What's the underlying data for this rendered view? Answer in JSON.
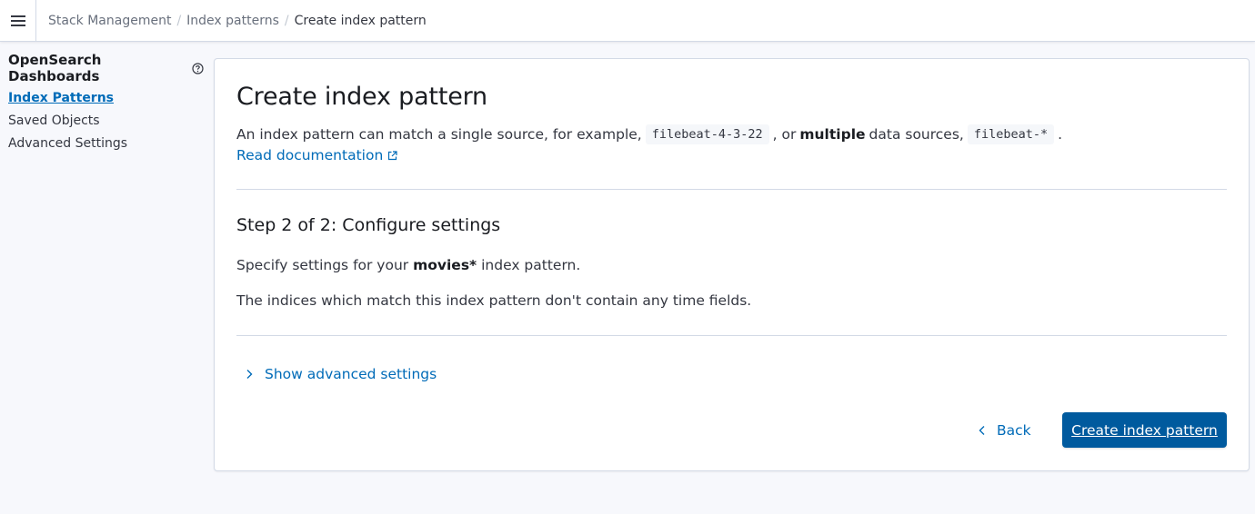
{
  "header": {
    "menu_icon": "hamburger-menu-icon",
    "breadcrumbs": [
      "Stack Management",
      "Index patterns",
      "Create index pattern"
    ],
    "separator": "/"
  },
  "sidebar": {
    "title": "OpenSearch Dashboards",
    "help_icon": "help-circle-icon",
    "items": [
      {
        "label": "Index Patterns",
        "active": true
      },
      {
        "label": "Saved Objects",
        "active": false
      },
      {
        "label": "Advanced Settings",
        "active": false
      }
    ]
  },
  "main": {
    "title": "Create index pattern",
    "description": {
      "part1": "An index pattern can match a single source, for example,",
      "code1": "filebeat-4-3-22",
      "part2": ", or",
      "bold": "multiple",
      "part3": "data sources,",
      "code2": "filebeat-*",
      "part4": "."
    },
    "read_docs_label": "Read documentation",
    "read_docs_icon": "external-link-icon",
    "step_title": "Step 2 of 2: Configure settings",
    "specify": {
      "prefix": "Specify settings for your",
      "pattern": "movies*",
      "suffix": "index pattern."
    },
    "time_fields_note": "The indices which match this index pattern don't contain any time fields.",
    "advanced_settings_label": "Show advanced settings",
    "back_label": "Back",
    "create_label": "Create index pattern"
  },
  "colors": {
    "link": "#006bb8",
    "primary_button": "#005a9e",
    "border": "#d3dae6",
    "page_background": "#f7f8fc"
  }
}
